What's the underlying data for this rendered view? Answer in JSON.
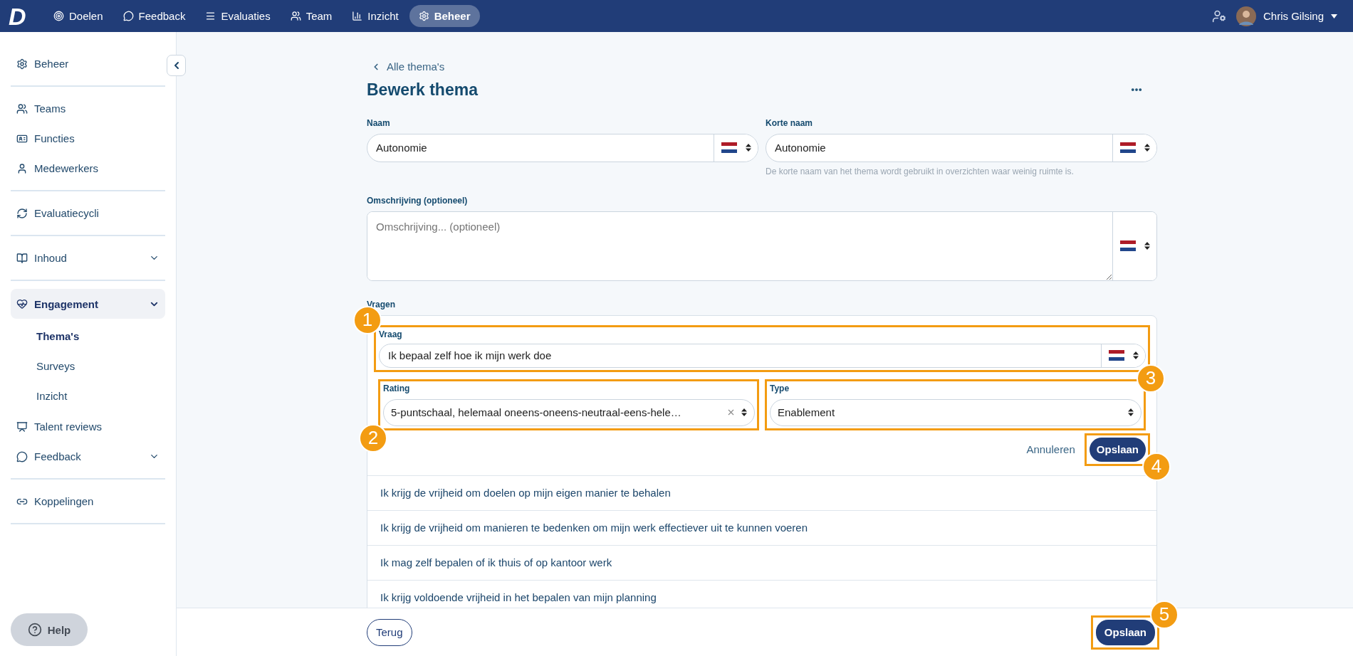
{
  "topbar": {
    "logo": "D",
    "nav": [
      {
        "label": "Doelen",
        "selected": false
      },
      {
        "label": "Feedback",
        "selected": false
      },
      {
        "label": "Evaluaties",
        "selected": false
      },
      {
        "label": "Team",
        "selected": false
      },
      {
        "label": "Inzicht",
        "selected": false
      },
      {
        "label": "Beheer",
        "selected": true
      }
    ],
    "user": {
      "name": "Chris Gilsing"
    }
  },
  "sidebar": {
    "groups": [
      [
        {
          "label": "Beheer",
          "expandable": false,
          "selected": false
        }
      ],
      [
        {
          "label": "Teams",
          "expandable": false,
          "selected": false
        },
        {
          "label": "Functies",
          "expandable": false,
          "selected": false
        },
        {
          "label": "Medewerkers",
          "expandable": false,
          "selected": false
        }
      ],
      [
        {
          "label": "Evaluatiecycli",
          "expandable": false,
          "selected": false
        }
      ],
      [
        {
          "label": "Inhoud",
          "expandable": true,
          "selected": false
        }
      ],
      [
        {
          "label": "Engagement",
          "expandable": true,
          "selected": true,
          "children": [
            {
              "label": "Thema's",
              "selected": true
            },
            {
              "label": "Surveys",
              "selected": false
            },
            {
              "label": "Inzicht",
              "selected": false
            }
          ]
        },
        {
          "label": "Talent reviews",
          "expandable": false,
          "selected": false
        },
        {
          "label": "Feedback",
          "expandable": true,
          "selected": false
        }
      ],
      [
        {
          "label": "Koppelingen",
          "expandable": false,
          "selected": false
        }
      ]
    ],
    "help": "Help"
  },
  "page": {
    "back_link": "Alle thema's",
    "title": "Bewerk thema",
    "name": {
      "label": "Naam",
      "value": "Autonomie"
    },
    "short_name": {
      "label": "Korte naam",
      "value": "Autonomie",
      "hint": "De korte naam van het thema wordt gebruikt in overzichten waar weinig ruimte is."
    },
    "description": {
      "label": "Omschrijving (optioneel)",
      "placeholder": "Omschrijving... (optioneel)"
    },
    "questions": {
      "label": "Vragen",
      "editor": {
        "question": {
          "label": "Vraag",
          "value": "Ik bepaal zelf hoe ik mijn werk doe",
          "callout": "1"
        },
        "rating": {
          "label": "Rating",
          "value": "5-puntschaal, helemaal oneens-oneens-neutraal-eens-hele…",
          "callout": "2"
        },
        "type": {
          "label": "Type",
          "value": "Enablement",
          "callout": "3"
        },
        "cancel": "Annuleren",
        "save": {
          "label": "Opslaan",
          "callout": "4"
        }
      },
      "items": [
        "Ik krijg de vrijheid om doelen op mijn eigen manier te behalen",
        "Ik krijg de vrijheid om manieren te bedenken om mijn werk effectiever uit te kunnen voeren",
        "Ik mag zelf bepalen of ik thuis of op kantoor werk",
        "Ik krijg voldoende vrijheid in het bepalen van mijn planning"
      ]
    }
  },
  "footer": {
    "back": "Terug",
    "save": {
      "label": "Opslaan",
      "callout": "5"
    }
  }
}
